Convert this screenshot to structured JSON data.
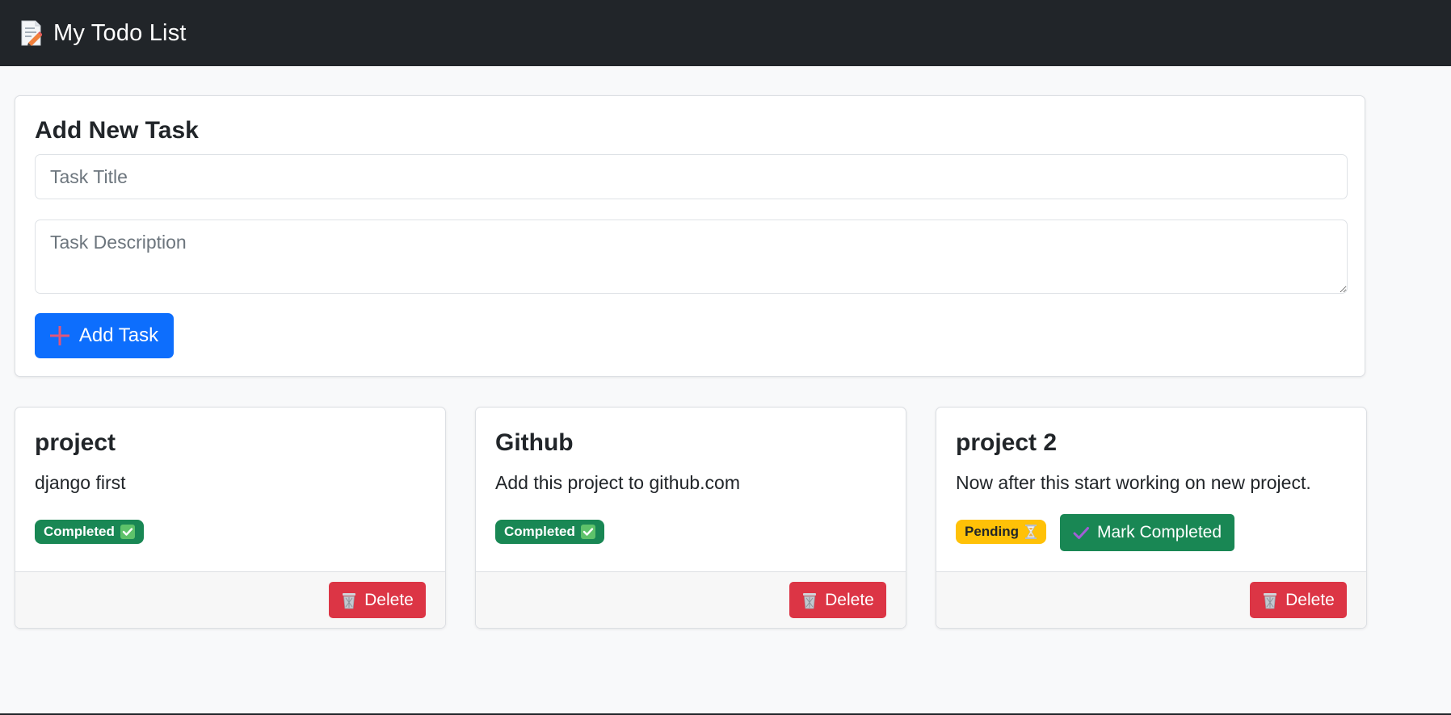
{
  "navbar": {
    "title": "My Todo List",
    "icon": "memo-icon"
  },
  "form": {
    "heading": "Add New Task",
    "title_placeholder": "Task Title",
    "description_placeholder": "Task Description",
    "submit_label": "Add Task",
    "submit_icon": "plus-icon"
  },
  "tasks": [
    {
      "title": "project",
      "description": "django first",
      "status": "Completed",
      "status_icon": "check-box-icon",
      "delete_label": "Delete"
    },
    {
      "title": "Github",
      "description": "Add this project to github.com",
      "status": "Completed",
      "status_icon": "check-box-icon",
      "delete_label": "Delete"
    },
    {
      "title": "project 2",
      "description": "Now after this start working on new project.",
      "status": "Pending",
      "status_icon": "hourglass-icon",
      "action_label": "Mark Completed",
      "delete_label": "Delete"
    }
  ],
  "colors": {
    "navbar": "#212529",
    "primary": "#0d6efd",
    "success": "#198754",
    "warning": "#ffc107",
    "danger": "#dc3545",
    "background": "#f8f9fa"
  }
}
